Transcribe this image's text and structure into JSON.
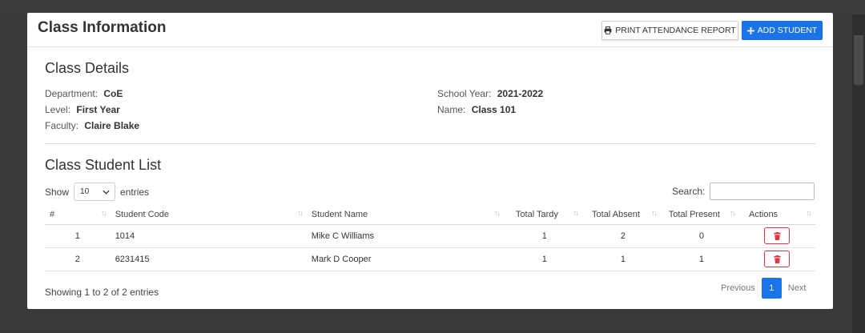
{
  "card": {
    "title": "Class Information",
    "print_label": "PRINT ATTENDANCE REPORT",
    "add_label": "ADD STUDENT"
  },
  "details": {
    "section_title": "Class Details",
    "department_label": "Department:",
    "department_value": "CoE",
    "level_label": "Level:",
    "level_value": "First Year",
    "faculty_label": "Faculty:",
    "faculty_value": "Claire Blake",
    "school_year_label": "School Year:",
    "school_year_value": "2021-2022",
    "name_label": "Name:",
    "name_value": "Class 101"
  },
  "students": {
    "section_title": "Class Student List",
    "show_label": "Show",
    "entries_label": "entries",
    "page_size": "10",
    "search_label": "Search:",
    "search_value": "",
    "columns": [
      "#",
      "Student Code",
      "Student Name",
      "Total Tardy",
      "Total Absent",
      "Total Present",
      "Actions"
    ],
    "rows": [
      {
        "index": "1",
        "code": "1014",
        "name": "Mike C Williams",
        "tardy": "1",
        "absent": "2",
        "present": "0"
      },
      {
        "index": "2",
        "code": "6231415",
        "name": "Mark D Cooper",
        "tardy": "1",
        "absent": "1",
        "present": "1"
      }
    ],
    "showing_text": "Showing 1 to 2 of 2 entries",
    "pagination": {
      "previous": "Previous",
      "current": "1",
      "next": "Next"
    }
  },
  "colors": {
    "accent": "#1a73e8",
    "danger": "#dc3545",
    "background": "#3a3a3a"
  },
  "icons": {
    "print": "printer-icon",
    "add": "plus-icon",
    "delete": "trash-icon",
    "sort": "sort-arrows-icon",
    "dropdown": "chevron-down-icon"
  }
}
